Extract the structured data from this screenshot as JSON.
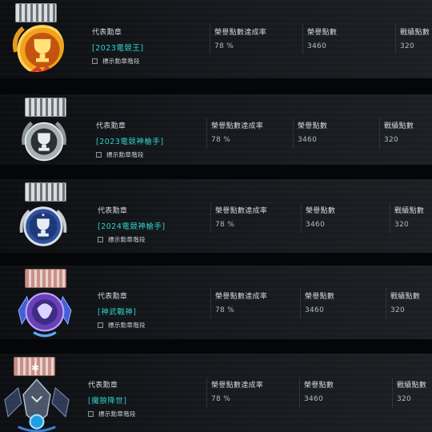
{
  "columns": {
    "rep_medal": "代表勳章",
    "rate": "榮譽點數達成率",
    "honor": "榮譽點數",
    "battle": "戰績點數"
  },
  "show_stage_label": "標示勳章階段",
  "rows": [
    {
      "medal_icon": "gold-trophy-medal-icon",
      "title": "[2023電競王]",
      "rate": "78 %",
      "honor": "3460",
      "battle": "320"
    },
    {
      "medal_icon": "silver-trophy-medal-icon",
      "title": "[2023電競神槍手]",
      "rate": "78 %",
      "honor": "3460",
      "battle": "320"
    },
    {
      "medal_icon": "blue-trophy-medal-icon",
      "title": "[2024電競神槍手]",
      "rate": "78 %",
      "honor": "3460",
      "battle": "320"
    },
    {
      "medal_icon": "dragon-crest-medal-icon",
      "title": "[神武戰神]",
      "rate": "78 %",
      "honor": "3460",
      "battle": "320"
    },
    {
      "medal_icon": "wolf-crest-medal-icon",
      "title": "[魔狼降世]",
      "rate": "78 %",
      "honor": "3460",
      "battle": "320"
    }
  ],
  "colors": {
    "accent_title": "#2fd0c8",
    "background": "#050608"
  }
}
